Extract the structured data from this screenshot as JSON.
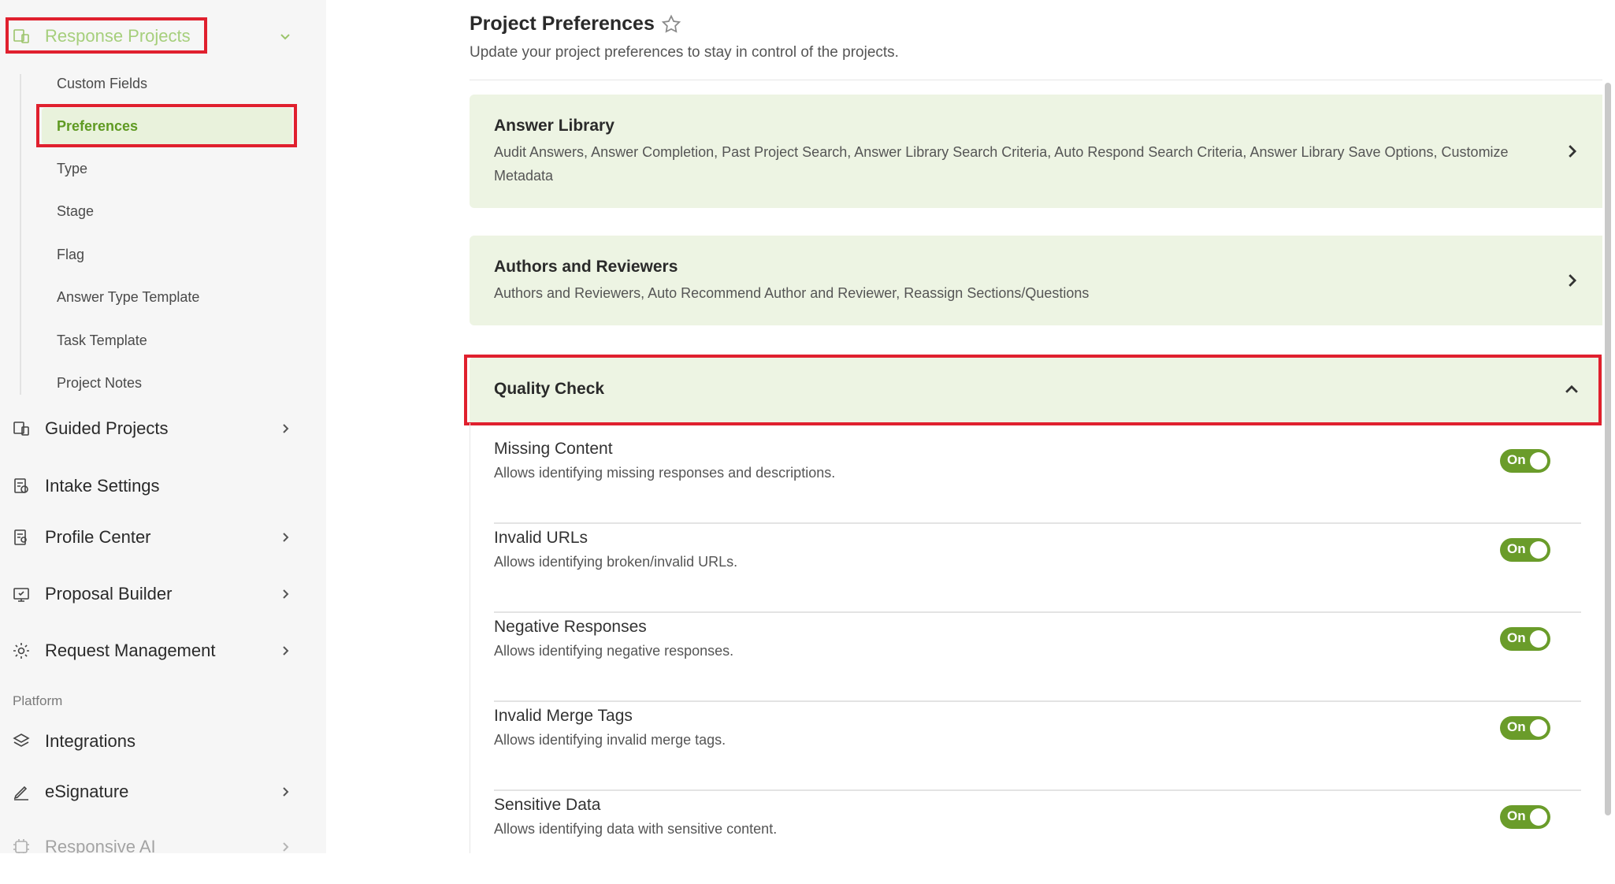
{
  "sidebar": {
    "response_projects": {
      "label": "Response Projects",
      "icon": "response-projects-icon"
    },
    "sub_items": [
      "Custom Fields",
      "Preferences",
      "Type",
      "Stage",
      "Flag",
      "Answer Type Template",
      "Task Template",
      "Project Notes"
    ],
    "active_sub_item": "Preferences",
    "nav": [
      {
        "label": "Guided Projects",
        "icon": "guided-projects-icon",
        "has_chevron": true
      },
      {
        "label": "Intake Settings",
        "icon": "intake-settings-icon",
        "has_chevron": false
      },
      {
        "label": "Profile Center",
        "icon": "profile-center-icon",
        "has_chevron": true
      },
      {
        "label": "Proposal Builder",
        "icon": "proposal-builder-icon",
        "has_chevron": true
      },
      {
        "label": "Request Management",
        "icon": "gear-icon",
        "has_chevron": true
      }
    ],
    "section_label": "Platform",
    "platform_nav": [
      {
        "label": "Integrations",
        "icon": "layers-icon",
        "has_chevron": false
      },
      {
        "label": "eSignature",
        "icon": "pen-icon",
        "has_chevron": true
      },
      {
        "label": "Responsive AI",
        "icon": "ai-chip-icon",
        "has_chevron": true
      }
    ]
  },
  "main": {
    "title": "Project Preferences",
    "subtitle": "Update your project preferences to stay in control of the projects.",
    "cards": [
      {
        "title": "Answer Library",
        "description": "Audit Answers, Answer Completion, Past Project Search, Answer Library Search Criteria, Auto Respond Search Criteria, Answer Library Save Options, Customize Metadata"
      },
      {
        "title": "Authors and Reviewers",
        "description": "Authors and Reviewers, Auto Recommend Author and Reviewer, Reassign Sections/Questions"
      }
    ],
    "quality_check": {
      "title": "Quality Check",
      "expanded": true,
      "items": [
        {
          "title": "Missing Content",
          "description": "Allows identifying missing responses and descriptions.",
          "toggle": "On"
        },
        {
          "title": "Invalid URLs",
          "description": "Allows identifying broken/invalid URLs.",
          "toggle": "On"
        },
        {
          "title": "Negative Responses",
          "description": "Allows identifying negative responses.",
          "toggle": "On"
        },
        {
          "title": "Invalid Merge Tags",
          "description": "Allows identifying invalid merge tags.",
          "toggle": "On"
        },
        {
          "title": "Sensitive Data",
          "description": "Allows identifying data with sensitive content.",
          "toggle": "On"
        }
      ]
    }
  },
  "colors": {
    "accent_green": "#6a9c2a",
    "active_text": "#5f9a22",
    "card_bg": "#edf4e3",
    "highlight_red": "#e0202e"
  }
}
